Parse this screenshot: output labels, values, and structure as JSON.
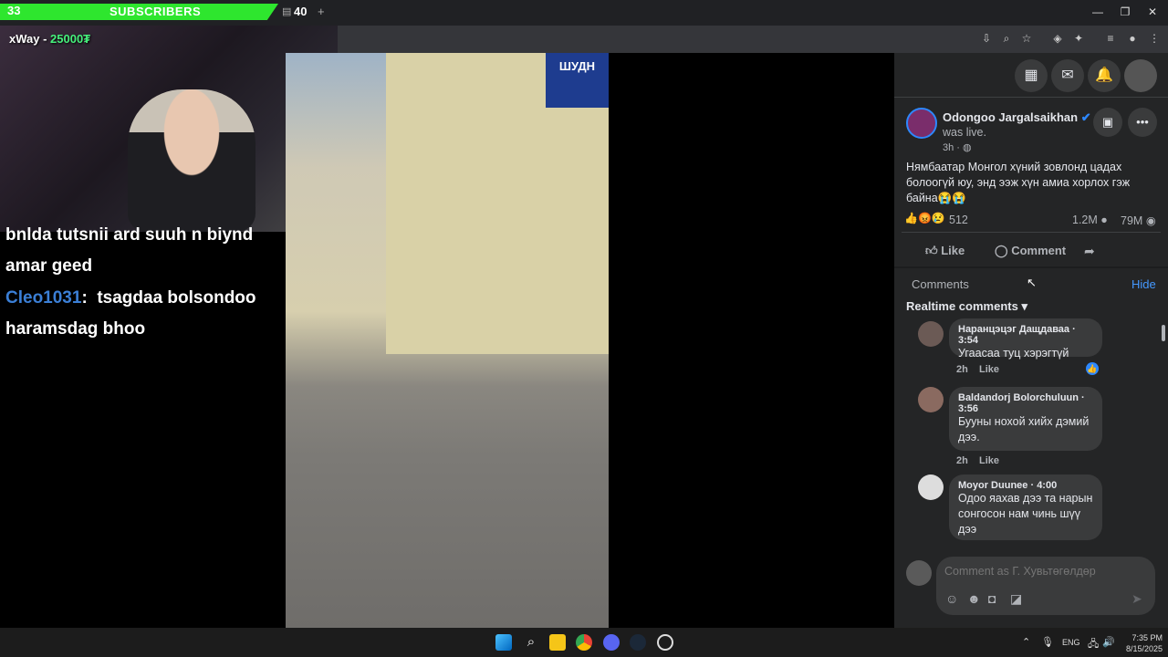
{
  "overlay": {
    "sub_count": "33",
    "sub_label": "SUBSCRIBERS",
    "goal_count": "40",
    "cam_tag_name": "xWay - ",
    "cam_tag_value": "25000₮"
  },
  "chat": {
    "line1": "bnlda tutsnii ard suuh n biynd",
    "line2": "amar geed",
    "user": "Cleo1031",
    "line3_msg": "tsagdaa bolsondoo",
    "line4": "haramsdag bhoo"
  },
  "video": {
    "sign_text": "ШУДН"
  },
  "post": {
    "author": "Odongoo Jargalsaikhan",
    "status": "was live.",
    "time": "3h",
    "text": "Нямбаатар Монгол хүний зовлонд цадах болоогүй юу, энд ээж хүн амиа хорлох гэж байна😭😭",
    "reaction_count": "512",
    "comment_count": "1.2M",
    "view_count": "79M",
    "like_label": "Like",
    "comment_label": "Comment"
  },
  "comments_section": {
    "title": "Comments",
    "hide_label": "Hide",
    "filter_label": "Realtime comments"
  },
  "comments": [
    {
      "name": "Наранцэцэг Дащдаваа",
      "ts": "3:54",
      "text": "Угаасаа туц хэрэгтүй",
      "age": "2h",
      "like": "Like"
    },
    {
      "name": "Baldandorj Bolorchuluun",
      "ts": "3:56",
      "text": "Бууны нохой хийх дэмий дээ.",
      "age": "2h",
      "like": "Like"
    },
    {
      "name": "Moyor Duunee",
      "ts": "4:00",
      "text": "Одоо яахав дээ та нарын сонгосон нам чинь шүү дээ"
    }
  ],
  "composer": {
    "placeholder": "Comment as Г. Хувьтөгөлдөр"
  },
  "taskbar": {
    "lang": "ENG",
    "time": "7:35 PM",
    "date": "8/15/2025"
  },
  "colors": {
    "fb_bg": "#242526",
    "sub_green": "#2ee62e",
    "chat_user": "#3b7fd6",
    "link_blue": "#4599ff"
  }
}
